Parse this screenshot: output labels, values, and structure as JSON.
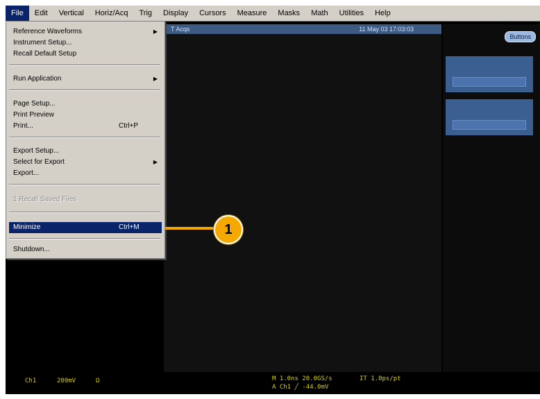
{
  "menubar": [
    "File",
    "Edit",
    "Vertical",
    "Horiz/Acq",
    "Trig",
    "Display",
    "Cursors",
    "Measure",
    "Masks",
    "Math",
    "Utilities",
    "Help"
  ],
  "screen": {
    "title_left": "T Acqs",
    "title_right": "11 May 03 17:03:03",
    "buttons_label": "Buttons"
  },
  "status": {
    "ch1": "Ch1",
    "scale": "200mV",
    "coupling": "Ω",
    "timebase": "M 1.0ns  20.0GS/s",
    "trig_status": "IT 1.0ps/pt",
    "trig_source": "A  Ch1  ╱  -44.0mV"
  },
  "file_menu": {
    "reference_waveforms": "Reference Waveforms",
    "instrument_setup": "Instrument Setup...",
    "recall_default_setup": "Recall Default Setup",
    "run_application": "Run Application",
    "page_setup": "Page Setup...",
    "print_preview": "Print Preview",
    "print": "Print...",
    "print_shortcut": "Ctrl+P",
    "export_setup": "Export Setup...",
    "select_for_export": "Select for Export",
    "export": "Export...",
    "disabled_item": "1 Recall Saved Files",
    "minimize": "Minimize",
    "minimize_shortcut": "Ctrl+M",
    "shutdown": "Shutdown..."
  },
  "callout": "1"
}
